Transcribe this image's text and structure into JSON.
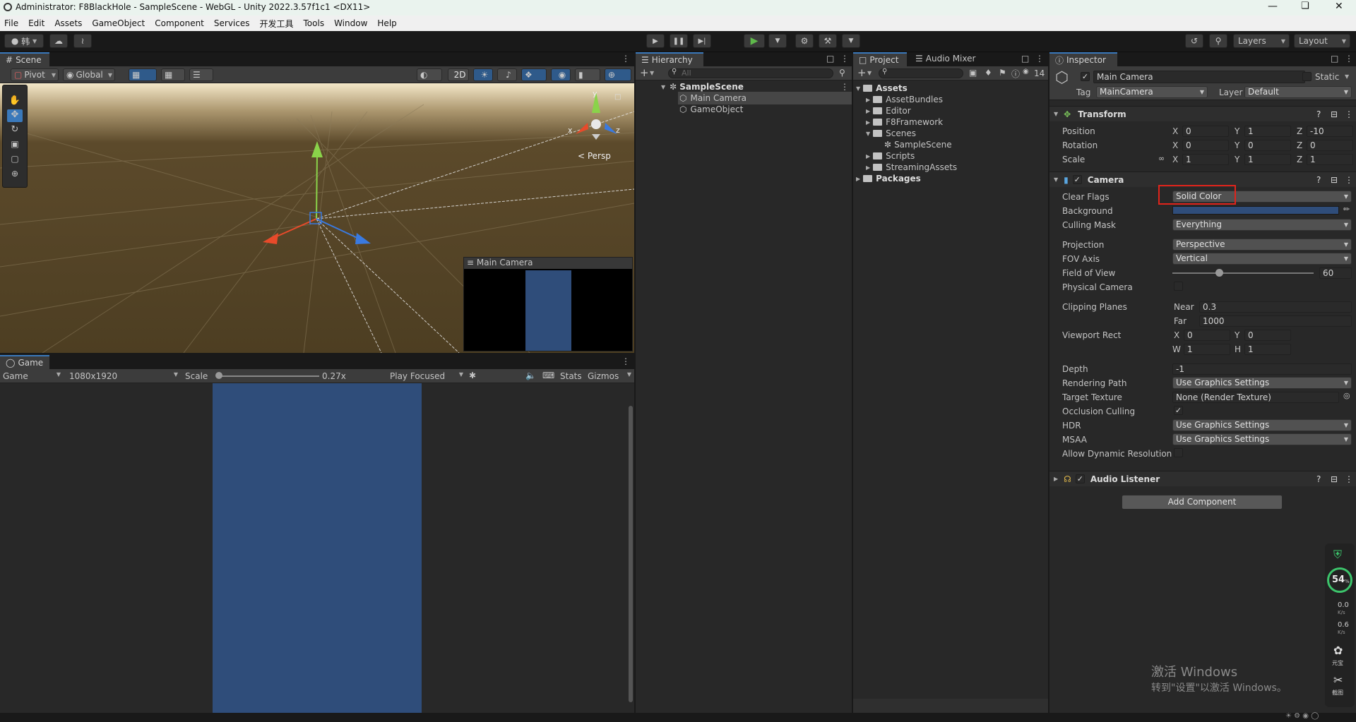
{
  "window": {
    "title": "Administrator: F8BlackHole - SampleScene - WebGL - Unity 2022.3.57f1c1 <DX11>"
  },
  "menu": [
    "File",
    "Edit",
    "Assets",
    "GameObject",
    "Component",
    "Services",
    "开发工具",
    "Tools",
    "Window",
    "Help"
  ],
  "toolbar": {
    "account": "韩",
    "layers": "Layers",
    "layout": "Layout"
  },
  "scene": {
    "tab": "Scene",
    "pivot": "Pivot",
    "global": "Global",
    "mode2d": "2D",
    "persp": "< Persp",
    "gizmo_y": "y",
    "gizmo_x": "x",
    "gizmo_z": "z",
    "preview_title": "Main Camera"
  },
  "game": {
    "tab": "Game",
    "display": "Game",
    "resolution": "1080x1920",
    "scale_label": "Scale",
    "scale_value": "0.27x",
    "play_focused": "Play Focused",
    "stats": "Stats",
    "gizmos": "Gizmos"
  },
  "hierarchy": {
    "tab": "Hierarchy",
    "search_placeholder": "All",
    "scene": "SampleScene",
    "items": [
      "Main Camera",
      "GameObject"
    ]
  },
  "project": {
    "tab": "Project",
    "tab2": "Audio Mixer",
    "count": "14",
    "root": "Assets",
    "folders": [
      "AssetBundles",
      "Editor",
      "F8Framework",
      "Scenes",
      "Scripts",
      "StreamingAssets"
    ],
    "scene_file": "SampleScene",
    "packages": "Packages"
  },
  "inspector": {
    "tab": "Inspector",
    "object_name": "Main Camera",
    "static_label": "Static",
    "tag_label": "Tag",
    "tag_value": "MainCamera",
    "layer_label": "Layer",
    "layer_value": "Default",
    "transform": {
      "title": "Transform",
      "position": {
        "label": "Position",
        "x": "0",
        "y": "1",
        "z": "-10"
      },
      "rotation": {
        "label": "Rotation",
        "x": "0",
        "y": "0",
        "z": "0"
      },
      "scale": {
        "label": "Scale",
        "x": "1",
        "y": "1",
        "z": "1"
      }
    },
    "camera": {
      "title": "Camera",
      "clear_flags": {
        "label": "Clear Flags",
        "value": "Solid Color"
      },
      "background": {
        "label": "Background",
        "color": "#2f4d7a"
      },
      "culling_mask": {
        "label": "Culling Mask",
        "value": "Everything"
      },
      "projection": {
        "label": "Projection",
        "value": "Perspective"
      },
      "fov_axis": {
        "label": "FOV Axis",
        "value": "Vertical"
      },
      "fov": {
        "label": "Field of View",
        "value": "60",
        "fraction": 0.33
      },
      "physical": {
        "label": "Physical Camera"
      },
      "clipping": {
        "label": "Clipping Planes",
        "near_label": "Near",
        "near": "0.3",
        "far_label": "Far",
        "far": "1000"
      },
      "viewport": {
        "label": "Viewport Rect",
        "x": "0",
        "y": "0",
        "w": "1",
        "h": "1"
      },
      "depth": {
        "label": "Depth",
        "value": "-1"
      },
      "rendering_path": {
        "label": "Rendering Path",
        "value": "Use Graphics Settings"
      },
      "target_texture": {
        "label": "Target Texture",
        "value": "None (Render Texture)"
      },
      "occlusion": {
        "label": "Occlusion Culling"
      },
      "hdr": {
        "label": "HDR",
        "value": "Use Graphics Settings"
      },
      "msaa": {
        "label": "MSAA",
        "value": "Use Graphics Settings"
      },
      "dynamic_res": {
        "label": "Allow Dynamic Resolution"
      }
    },
    "audio_listener": {
      "title": "Audio Listener"
    },
    "add_component": "Add Component"
  },
  "overlay": {
    "activate_title": "激活 Windows",
    "activate_sub": "转到\"设置\"以激活 Windows。",
    "cpu": "54",
    "cpu_unit": "%",
    "net_up": "0.0",
    "net_down": "0.6",
    "net_unit": "K/s",
    "label_a": "元宝",
    "label_b": "截图"
  },
  "colors": {
    "accent": "#3a79bb",
    "highlight_box": "#e0241b",
    "game_bg": "#2f4d7a",
    "play": "#5fb94b"
  }
}
